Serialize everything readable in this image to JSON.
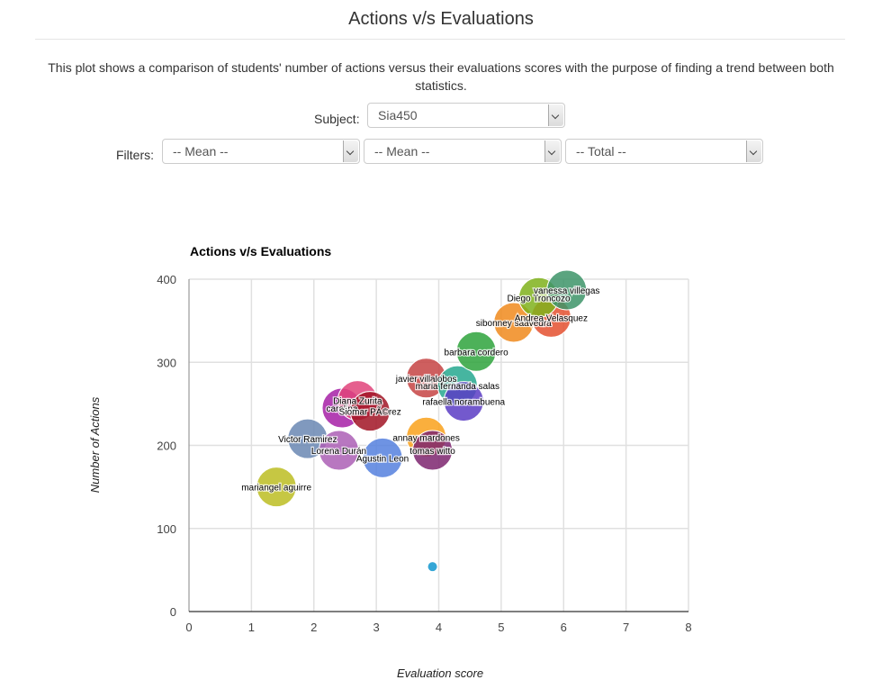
{
  "page": {
    "title": "Actions v/s Evaluations",
    "description": "This plot shows a comparison of students' number of actions versus their evaluations scores with the purpose of finding a trend between both statistics."
  },
  "controls": {
    "subject_label": "Subject:",
    "subject_value": "Sia450",
    "filters_label": "Filters:",
    "filter1_value": "-- Mean --",
    "filter2_value": "-- Mean --",
    "filter3_value": "-- Total --"
  },
  "chart_data": {
    "type": "scatter",
    "title": "Actions v/s Evaluations",
    "xlabel": "Evaluation score",
    "ylabel": "Number of Actions",
    "xlim": [
      0,
      8
    ],
    "ylim": [
      0,
      400
    ],
    "xticks": [
      "0",
      "1",
      "2",
      "3",
      "4",
      "5",
      "6",
      "7",
      "8"
    ],
    "yticks": [
      "0",
      "100",
      "200",
      "300",
      "400"
    ],
    "grid": true,
    "points": [
      {
        "name": "mariangel aguirre",
        "x": 1.4,
        "y": 150,
        "color": "#bcbd22"
      },
      {
        "name": "Victor Ramirez",
        "x": 1.9,
        "y": 208,
        "color": "#6a87b3"
      },
      {
        "name": "Lorena Durán",
        "x": 2.4,
        "y": 194,
        "color": "#ab5fb5"
      },
      {
        "name": "carolina",
        "x": 2.45,
        "y": 245,
        "color": "#a620a6"
      },
      {
        "name": "Diana Zurita",
        "x": 2.7,
        "y": 254,
        "color": "#e0437a"
      },
      {
        "name": "Siomar PÃ©rez",
        "x": 2.9,
        "y": 241,
        "color": "#a11424"
      },
      {
        "name": "Agustin Leon",
        "x": 3.1,
        "y": 185,
        "color": "#5580de"
      },
      {
        "name": "annay mardones",
        "x": 3.8,
        "y": 210,
        "color": "#f9a11b"
      },
      {
        "name": "tomas witto",
        "x": 3.9,
        "y": 194,
        "color": "#7d246e"
      },
      {
        "name": "javier villalobos",
        "x": 3.8,
        "y": 281,
        "color": "#c64343"
      },
      {
        "name": "maria fernanda salas",
        "x": 4.3,
        "y": 272,
        "color": "#26a88f"
      },
      {
        "name": "rafaella norambuena",
        "x": 4.4,
        "y": 253,
        "color": "#5b3cc4"
      },
      {
        "name": "barbara cordero",
        "x": 4.6,
        "y": 313,
        "color": "#2ea33c"
      },
      {
        "name": "sibonney saavedra",
        "x": 5.2,
        "y": 348,
        "color": "#f08a1c"
      },
      {
        "name": "Andrea Velasquez",
        "x": 5.8,
        "y": 354,
        "color": "#e4502f"
      },
      {
        "name": "Diego Troncozo",
        "x": 5.6,
        "y": 378,
        "color": "#7fb11b"
      },
      {
        "name": "vanessa villegas",
        "x": 6.05,
        "y": 387,
        "color": "#3d9468"
      },
      {
        "name": "",
        "x": 3.9,
        "y": 54,
        "color": "#35a6d6",
        "small": true
      }
    ]
  }
}
